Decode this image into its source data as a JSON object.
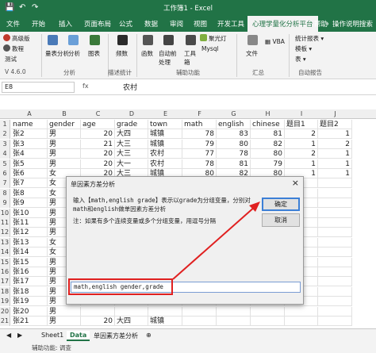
{
  "window": {
    "title": "工作簿1 - Excel"
  },
  "tabs": [
    "文件",
    "开始",
    "插入",
    "页面布局",
    "公式",
    "数据",
    "审阅",
    "视图",
    "开发工具",
    "帮助"
  ],
  "active_tab": "心理学量化分析平台",
  "help_search": "操作说明搜索",
  "ribbon": {
    "left_items": [
      "高级版",
      "教程",
      "测试"
    ],
    "big_buttons": [
      "量表分析",
      "分析",
      "图表",
      "频数",
      "函数",
      "自动前处理",
      "工具箱",
      "文件"
    ],
    "labels": {
      "mysql": "Mysql",
      "vba": "VBA",
      "spotlight": "聚光灯",
      "stats_report": "统计报表",
      "template": "模板",
      "table": "表"
    },
    "groups": [
      "V 4.6.0",
      "分析",
      "描述统计",
      "辅助功能",
      "汇总",
      "自动报告"
    ]
  },
  "formula": {
    "cell": "E8",
    "fx": "fx",
    "content": "农村"
  },
  "columns": [
    "A",
    "B",
    "C",
    "D",
    "E",
    "F",
    "G",
    "H",
    "I",
    "J"
  ],
  "rows": [
    {
      "n": "1",
      "c": [
        "name",
        "gender",
        "age",
        "grade",
        "town",
        "math",
        "english",
        "chinese",
        "题目1",
        "题目2"
      ]
    },
    {
      "n": "2",
      "c": [
        "张2",
        "男",
        "20",
        "大四",
        "城镇",
        "78",
        "83",
        "81",
        "2",
        "1"
      ]
    },
    {
      "n": "3",
      "c": [
        "张3",
        "男",
        "21",
        "大三",
        "城镇",
        "79",
        "80",
        "82",
        "1",
        "2"
      ]
    },
    {
      "n": "4",
      "c": [
        "张4",
        "男",
        "20",
        "大三",
        "农村",
        "77",
        "78",
        "80",
        "2",
        "1"
      ]
    },
    {
      "n": "5",
      "c": [
        "张5",
        "男",
        "20",
        "大一",
        "农村",
        "78",
        "81",
        "79",
        "1",
        "1"
      ]
    },
    {
      "n": "6",
      "c": [
        "张6",
        "女",
        "20",
        "大三",
        "城镇",
        "80",
        "82",
        "80",
        "1",
        "1"
      ]
    },
    {
      "n": "7",
      "c": [
        "张7",
        "女",
        "",
        "",
        "",
        "",
        "",
        "",
        "",
        ""
      ]
    },
    {
      "n": "8",
      "c": [
        "张8",
        "女",
        "",
        "",
        "",
        "",
        "",
        "",
        "",
        ""
      ]
    },
    {
      "n": "9",
      "c": [
        "张9",
        "男",
        "",
        "",
        "",
        "",
        "",
        "",
        "",
        ""
      ]
    },
    {
      "n": "10",
      "c": [
        "张10",
        "男",
        "",
        "",
        "",
        "",
        "",
        "",
        "",
        ""
      ]
    },
    {
      "n": "11",
      "c": [
        "张11",
        "男",
        "",
        "",
        "",
        "",
        "",
        "",
        "",
        ""
      ]
    },
    {
      "n": "12",
      "c": [
        "张12",
        "男",
        "",
        "",
        "",
        "",
        "",
        "",
        "",
        ""
      ]
    },
    {
      "n": "13",
      "c": [
        "张13",
        "女",
        "",
        "",
        "",
        "",
        "",
        "",
        "",
        ""
      ]
    },
    {
      "n": "14",
      "c": [
        "张14",
        "女",
        "",
        "",
        "",
        "",
        "",
        "",
        "",
        ""
      ]
    },
    {
      "n": "15",
      "c": [
        "张15",
        "男",
        "",
        "",
        "",
        "",
        "",
        "",
        "",
        ""
      ]
    },
    {
      "n": "16",
      "c": [
        "张16",
        "男",
        "",
        "",
        "",
        "",
        "",
        "",
        "",
        ""
      ]
    },
    {
      "n": "17",
      "c": [
        "张17",
        "男",
        "",
        "",
        "",
        "",
        "",
        "",
        "",
        ""
      ]
    },
    {
      "n": "18",
      "c": [
        "张18",
        "男",
        "",
        "",
        "",
        "",
        "",
        "",
        "",
        ""
      ]
    },
    {
      "n": "19",
      "c": [
        "张19",
        "男",
        "",
        "",
        "",
        "",
        "",
        "",
        "",
        ""
      ]
    },
    {
      "n": "20",
      "c": [
        "张20",
        "男",
        "",
        "",
        "",
        "",
        "",
        "",
        "",
        ""
      ]
    },
    {
      "n": "21",
      "c": [
        "张21",
        "男",
        "20",
        "大四",
        "城镇",
        "",
        "",
        "",
        "",
        ""
      ]
    }
  ],
  "dialog": {
    "title": "单因素方差分析",
    "close": "×",
    "instruction": "输入【math,english grade】表示以grade为分组变量，分别对math和english做单因素方差分析",
    "note": "注：如果有多个连续变量或多个分组变量，用逗号分隔",
    "ok": "确定",
    "cancel": "取消",
    "input_value": "math,english gender,grade"
  },
  "sheet_tabs": [
    "Sheet1",
    "Data",
    "单因素方差分析"
  ],
  "active_sheet": "Data",
  "status": "辅助功能: 调查",
  "colors": {
    "excel_green": "#217346",
    "highlight_red": "#e02020"
  }
}
